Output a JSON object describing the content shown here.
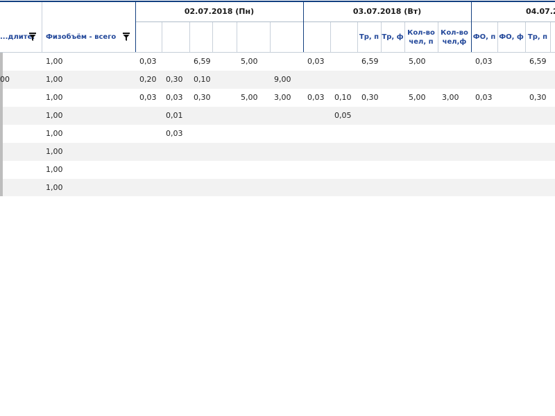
{
  "header": {
    "dates": [
      {
        "label": "02.07.2018 (Пн)"
      },
      {
        "label": "03.07.2018 (Вт)"
      },
      {
        "label": "04.07.2"
      }
    ],
    "columns": [
      {
        "key": "name",
        "label": "...длите."
      },
      {
        "key": "vol",
        "label": "Физобъём - всего"
      },
      {
        "key": "d1c1",
        "label": ""
      },
      {
        "key": "d1c2",
        "label": ""
      },
      {
        "key": "d1c3",
        "label": ""
      },
      {
        "key": "d1c4",
        "label": ""
      },
      {
        "key": "d1c5",
        "label": ""
      },
      {
        "key": "d1c6",
        "label": ""
      },
      {
        "key": "d2c1",
        "label": ""
      },
      {
        "key": "d2c2",
        "label": ""
      },
      {
        "key": "d2c3",
        "label": "Тр, п"
      },
      {
        "key": "d2c4",
        "label": "Тр, ф"
      },
      {
        "key": "d2c5",
        "label": "Кол-во\nчел, п"
      },
      {
        "key": "d2c6",
        "label": "Кол-во\nчел,ф"
      },
      {
        "key": "d3c1",
        "label": "ФО, п"
      },
      {
        "key": "d3c2",
        "label": "ФО, ф"
      },
      {
        "key": "d3c3",
        "label": "Тр, п"
      },
      {
        "key": "d3c4",
        "label": ""
      }
    ]
  },
  "rows": [
    [
      "",
      "1,00",
      "0,03",
      "",
      "6,59",
      "",
      "5,00",
      "",
      "0,03",
      "",
      "6,59",
      "",
      "5,00",
      "",
      "0,03",
      "",
      "6,59",
      ""
    ],
    [
      "00",
      "1,00",
      "0,20",
      "0,30",
      "0,10",
      "",
      "",
      "9,00",
      "",
      "",
      "",
      "",
      "",
      "",
      "",
      "",
      "",
      ""
    ],
    [
      "",
      "1,00",
      "0,03",
      "0,03",
      "0,30",
      "",
      "5,00",
      "3,00",
      "0,03",
      "0,10",
      "0,30",
      "",
      "5,00",
      "3,00",
      "0,03",
      "",
      "0,30",
      ""
    ],
    [
      "",
      "1,00",
      "",
      "0,01",
      "",
      "",
      "",
      "",
      "",
      "0,05",
      "",
      "",
      "",
      "",
      "",
      "",
      "",
      ""
    ],
    [
      "",
      "1,00",
      "",
      "0,03",
      "",
      "",
      "",
      "",
      "",
      "",
      "",
      "",
      "",
      "",
      "",
      "",
      "",
      ""
    ],
    [
      "",
      "1,00",
      "",
      "",
      "",
      "",
      "",
      "",
      "",
      "",
      "",
      "",
      "",
      "",
      "",
      "",
      "",
      ""
    ],
    [
      "",
      "1,00",
      "",
      "",
      "",
      "",
      "",
      "",
      "",
      "",
      "",
      "",
      "",
      "",
      "",
      "",
      "",
      ""
    ],
    [
      "",
      "1,00",
      "",
      "",
      "",
      "",
      "",
      "",
      "",
      "",
      "",
      "",
      "",
      "",
      "",
      "",
      "",
      ""
    ]
  ],
  "colors": {
    "header_text": "#23489a",
    "border_strong": "#123f80",
    "row_alt": "#f2f2f2"
  },
  "icons": {
    "filter": "filter-icon"
  }
}
